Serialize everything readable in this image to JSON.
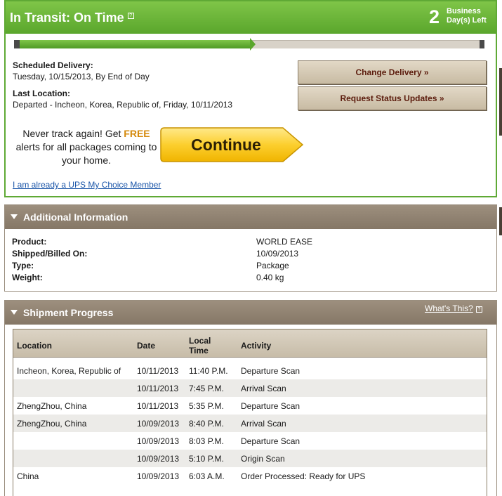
{
  "status": {
    "title": "In Transit: On Time",
    "help_glyph": "?",
    "days_count": "2",
    "days_label_line1": "Business",
    "days_label_line2": "Day(s) Left",
    "progress_fraction": 0.5,
    "accent_color": "#5fa935"
  },
  "delivery": {
    "scheduled_label": "Scheduled Delivery:",
    "scheduled_value": "Tuesday, 10/15/2013, By End of Day",
    "last_location_label": "Last Location:",
    "last_location_value": "Departed - Incheon, Korea, Republic of, Friday, 10/11/2013"
  },
  "actions": {
    "change_delivery": "Change Delivery »",
    "request_updates": "Request Status Updates »"
  },
  "promo": {
    "text_before": "Never track again! Get ",
    "text_free": "FREE",
    "text_after": " alerts for all packages coming to your home.",
    "continue_label": "Continue",
    "member_link": "I am already a UPS My Choice Member"
  },
  "additional": {
    "title": "Additional Information",
    "rows": [
      {
        "label": "Product:",
        "value": "WORLD EASE"
      },
      {
        "label": "Shipped/Billed On:",
        "value": "10/09/2013"
      },
      {
        "label": "Type:",
        "value": "Package"
      },
      {
        "label": "Weight:",
        "value": "0.40 kg"
      }
    ]
  },
  "shipment_progress": {
    "title": "Shipment Progress",
    "whats_this": "What's This?",
    "help_glyph": "?",
    "columns": {
      "location": "Location",
      "date": "Date",
      "local_time_line1": "Local",
      "local_time_line2": "Time",
      "activity": "Activity"
    },
    "rows": [
      {
        "location": "Incheon, Korea, Republic of",
        "date": "10/11/2013",
        "time": "11:40 P.M.",
        "activity": "Departure Scan"
      },
      {
        "location": "",
        "date": "10/11/2013",
        "time": "7:45 P.M.",
        "activity": "Arrival Scan"
      },
      {
        "location": "ZhengZhou, China",
        "date": "10/11/2013",
        "time": "5:35 P.M.",
        "activity": "Departure Scan"
      },
      {
        "location": "ZhengZhou, China",
        "date": "10/09/2013",
        "time": "8:40 P.M.",
        "activity": "Arrival Scan"
      },
      {
        "location": "",
        "date": "10/09/2013",
        "time": "8:03 P.M.",
        "activity": "Departure Scan"
      },
      {
        "location": "",
        "date": "10/09/2013",
        "time": "5:10 P.M.",
        "activity": "Origin Scan"
      },
      {
        "location": "China",
        "date": "10/09/2013",
        "time": "6:03 A.M.",
        "activity": "Order Processed: Ready for UPS"
      }
    ]
  }
}
